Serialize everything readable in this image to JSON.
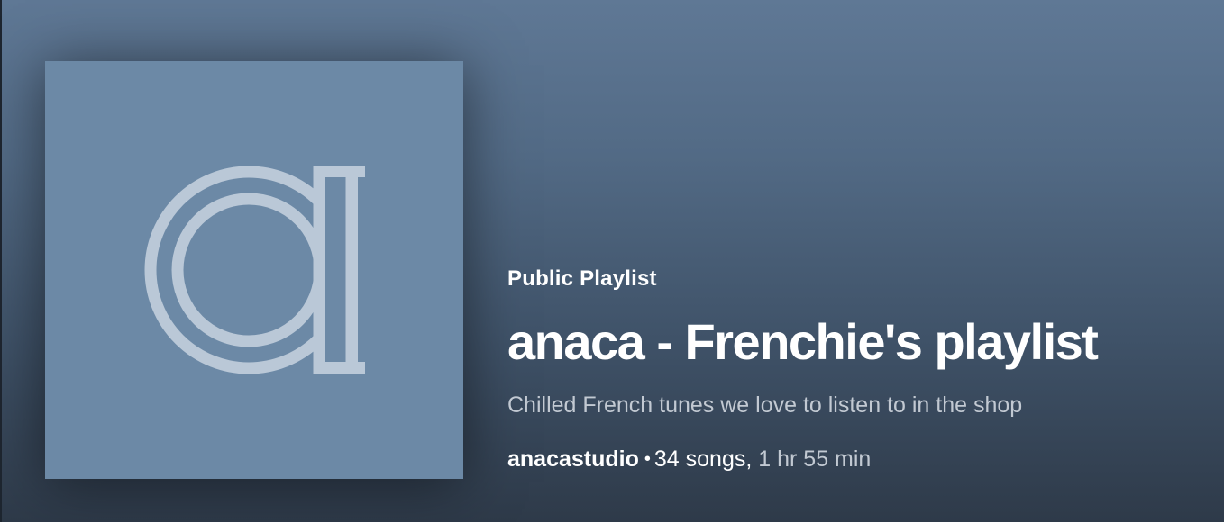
{
  "playlist": {
    "type_label": "Public Playlist",
    "title": "anaca - Frenchie's playlist",
    "description": "Chilled French tunes we love to listen to in the shop",
    "owner": "anacastudio",
    "separator": "•",
    "song_count": "34 songs,",
    "duration": "1 hr 55 min",
    "cover_icon": "anaca-logo",
    "colors": {
      "cover_background": "#6c89a6",
      "logo_stroke": "#bac8d7",
      "header_gradient_top": "#5f7895",
      "header_gradient_bottom": "#2e3a49"
    }
  }
}
